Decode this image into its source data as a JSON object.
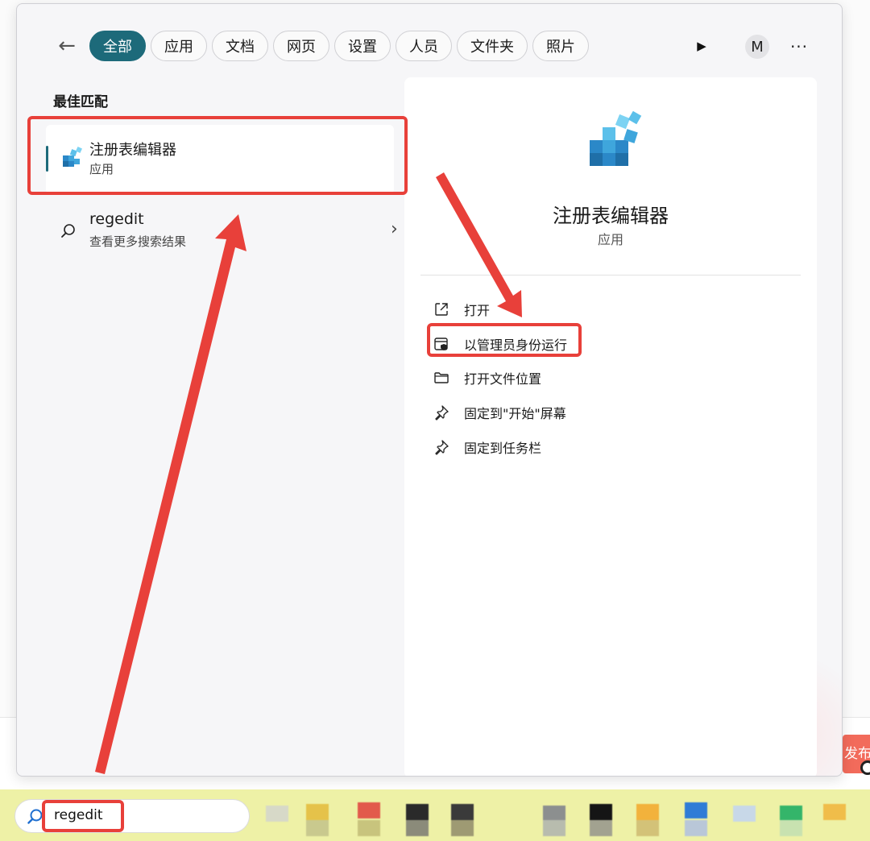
{
  "filter_bar": {
    "back_label": "←",
    "chips": [
      "全部",
      "应用",
      "文档",
      "网页",
      "设置",
      "人员",
      "文件夹",
      "照片"
    ],
    "active_chip": "全部",
    "account_initial": "M",
    "more_label": "···"
  },
  "results": {
    "section_title": "最佳匹配",
    "best_match": {
      "name": "注册表编辑器",
      "type": "应用"
    },
    "web_search": {
      "query": "regedit",
      "subtitle": "查看更多搜索结果"
    }
  },
  "detail": {
    "title": "注册表编辑器",
    "type": "应用",
    "actions": [
      {
        "label": "打开",
        "icon": "open-external-icon"
      },
      {
        "label": "以管理员身份运行",
        "icon": "shield-admin-icon"
      },
      {
        "label": "打开文件位置",
        "icon": "folder-icon"
      },
      {
        "label": "固定到\"开始\"屏幕",
        "icon": "pin-icon"
      },
      {
        "label": "固定到任务栏",
        "icon": "pin-icon"
      }
    ]
  },
  "taskbar": {
    "search_value": "regedit"
  },
  "background": {
    "side_badge_text": "发布"
  },
  "colors": {
    "accent": "#1d6a7a",
    "annotation": "#e8403a",
    "taskbar": "#eef1a6"
  }
}
